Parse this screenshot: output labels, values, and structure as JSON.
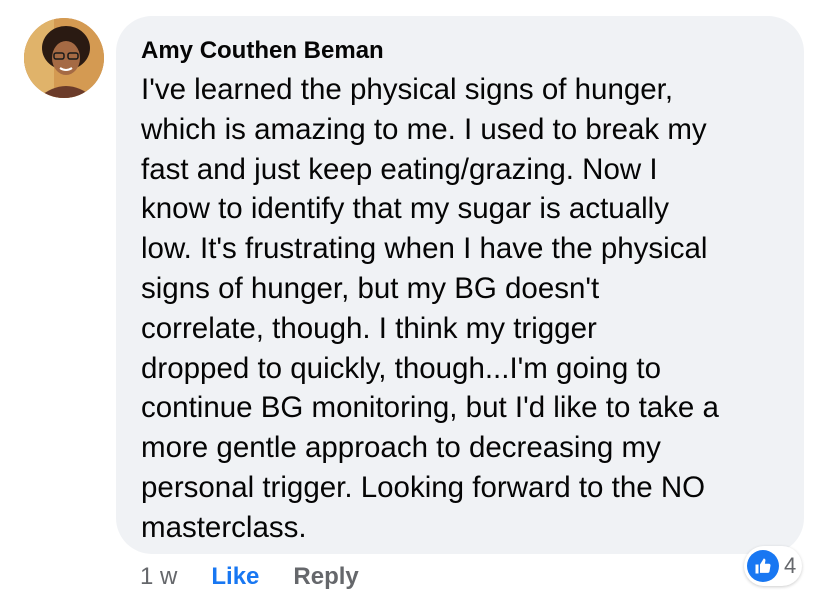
{
  "comment": {
    "author": "Amy Couthen Beman",
    "text": "I've learned the physical signs of hunger,\nwhich is amazing to me. I used to break my\nfast and just keep eating/grazing. Now I\nknow to identify that my sugar is actually\nlow. It's frustrating when I have the physical\nsigns of hunger, but my BG doesn't\ncorrelate, though. I think my trigger\ndropped to quickly, though...I'm going to\ncontinue BG monitoring, but I'd like to take a\nmore gentle approach to decreasing my\npersonal trigger. Looking forward to the NO\nmasterclass."
  },
  "actions": {
    "timestamp": "1 w",
    "like_label": "Like",
    "reply_label": "Reply"
  },
  "reactions": {
    "icon": "thumbs-up-icon",
    "count": "4"
  },
  "colors": {
    "bubble_bg": "#f0f2f5",
    "accent": "#1877f2",
    "secondary_text": "#65676b"
  }
}
